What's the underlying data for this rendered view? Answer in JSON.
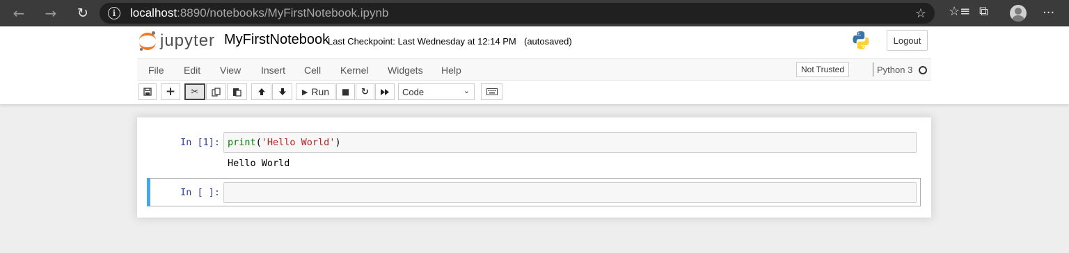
{
  "browser": {
    "url_host": "localhost",
    "url_rest": ":8890/notebooks/MyFirstNotebook.ipynb",
    "back_icon": "←",
    "forward_icon": "→",
    "refresh_icon": "↻",
    "info_icon": "i",
    "favorites_icon": "☆",
    "collections_icon": "⧉",
    "more_icon": "···"
  },
  "header": {
    "logo_text": "jupyter",
    "notebook_name": "MyFirstNotebook",
    "checkpoint": "Last Checkpoint: Last Wednesday at 12:14 PM",
    "autosave": "(autosaved)",
    "logout_label": "Logout"
  },
  "menu": {
    "items": [
      "File",
      "Edit",
      "View",
      "Insert",
      "Cell",
      "Kernel",
      "Widgets",
      "Help"
    ],
    "trust_label": "Not Trusted",
    "kernel_name": "Python 3"
  },
  "toolbar": {
    "save_icon": "🖫",
    "add_icon": "+",
    "cut_icon": "✂",
    "copy_icon": "⎘",
    "paste_icon": "📋",
    "move_up_icon": "🡅",
    "move_down_icon": "🡇",
    "run_label": "Run",
    "run_icon": "▶",
    "stop_icon": "■",
    "restart_icon": "↻",
    "fast_forward_icon": "⏩",
    "cell_type": "Code",
    "keyboard_icon": "⌨"
  },
  "cells": [
    {
      "prompt": "In [1]:",
      "code_fn": "print",
      "code_open": "(",
      "code_str": "'Hello World'",
      "code_close": ")",
      "output": "Hello World"
    },
    {
      "prompt": "In [ ]:",
      "code": ""
    }
  ],
  "colors": {
    "accent": "#f37726",
    "selected_cell": "#42a5f5",
    "prompt": "#303f9f"
  }
}
